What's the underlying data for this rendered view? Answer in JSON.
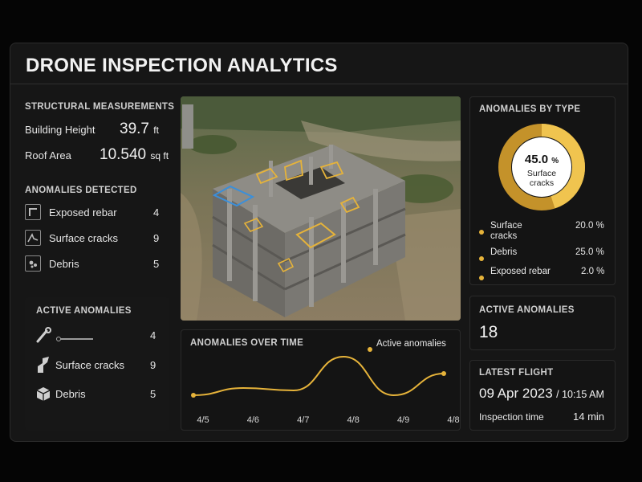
{
  "header": {
    "title": "DRONE INSPECTION ANALYTICS"
  },
  "measurements": {
    "title": "STRUCTURAL MEASUREMENTS",
    "height_label": "Building Height",
    "height_value": "39.7",
    "height_unit": "ft",
    "roof_label": "Roof Area",
    "roof_value": "10.540",
    "roof_unit": "sq ft"
  },
  "detected": {
    "title": "ANOMALIES DETECTED",
    "items": [
      {
        "label": "Exposed rebar",
        "count": "4",
        "icon": "rebar-icon"
      },
      {
        "label": "Surface cracks",
        "count": "9",
        "icon": "crack-icon"
      },
      {
        "label": "Debris",
        "count": "5",
        "icon": "debris-icon"
      }
    ]
  },
  "active_list": {
    "title": "ACTIVE ANOMALIES",
    "items": [
      {
        "label": "",
        "count": "4",
        "icon": "wrench-icon"
      },
      {
        "label": "Surface cracks",
        "count": "9",
        "icon": "crack-icon"
      },
      {
        "label": "Debris",
        "count": "5",
        "icon": "box-icon"
      }
    ]
  },
  "by_type": {
    "title": "ANOMALIES BY TYPE",
    "center_value": "45.0",
    "center_unit": "%",
    "center_label_1": "Surface",
    "center_label_2": "cracks",
    "legend": [
      {
        "label_1": "Surface",
        "label_2": "cracks",
        "value": "20.0 %"
      },
      {
        "label_1": "Debris",
        "label_2": "",
        "value": "25.0 %"
      },
      {
        "label_1": "Exposed rebar",
        "label_2": "",
        "value": "2.0 %"
      }
    ]
  },
  "active_card": {
    "title": "ACTIVE ANOMALIES",
    "value": "18"
  },
  "latest_flight": {
    "title": "LATEST FLIGHT",
    "date": "09 Apr 2023",
    "time": "/ 10:15 AM",
    "inspection_label": "Inspection time",
    "inspection_value": "14 min"
  },
  "colors": {
    "accent": "#e6b33a",
    "highlight": "#3b8fd9",
    "background": "#161616"
  },
  "chart_data": {
    "type": "line",
    "title": "ANOMALIES OVER TIME",
    "legend": "Active anomalies",
    "legend_position": "top-right",
    "categories": [
      "4/5",
      "4/6",
      "4/7",
      "4/8",
      "4/9",
      "4/8"
    ],
    "series": [
      {
        "name": "Active anomalies",
        "values": [
          2,
          5,
          4,
          18,
          2,
          11
        ]
      }
    ],
    "ylim": [
      0,
      20
    ],
    "grid": false
  }
}
